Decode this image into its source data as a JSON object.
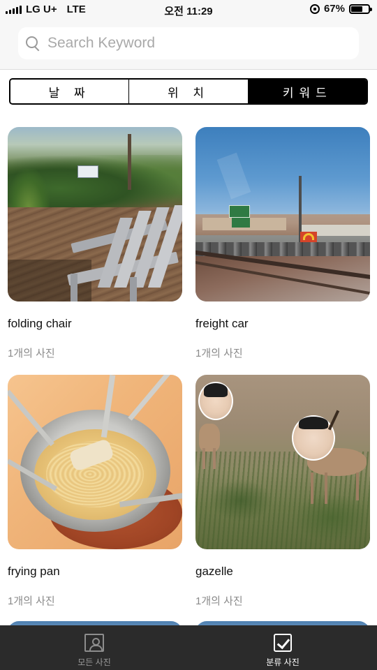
{
  "status_bar": {
    "carrier": "LG U+",
    "network": "LTE",
    "time": "오전 11:29",
    "battery": "67%",
    "battery_level": 0.67
  },
  "search": {
    "placeholder": "Search Keyword",
    "value": ""
  },
  "segments": [
    {
      "label": "날 짜",
      "selected": false
    },
    {
      "label": "위 치",
      "selected": false
    },
    {
      "label": "키워드",
      "selected": true
    }
  ],
  "cards": [
    {
      "keyword": "folding chair",
      "count": "1개의 사진"
    },
    {
      "keyword": "freight car",
      "count": "1개의 사진"
    },
    {
      "keyword": "frying pan",
      "count": "1개의 사진"
    },
    {
      "keyword": "gazelle",
      "count": "1개의 사진"
    }
  ],
  "tab_bar": {
    "tabs": [
      {
        "label": "모든 사진",
        "icon": "photo-portrait-icon",
        "active": false
      },
      {
        "label": "분류 사진",
        "icon": "checkbox-icon",
        "active": true
      }
    ]
  },
  "colors": {
    "accent": "#000000",
    "tab_bar_bg": "#2b2b2b",
    "secondary_text": "#8a8a8a"
  }
}
